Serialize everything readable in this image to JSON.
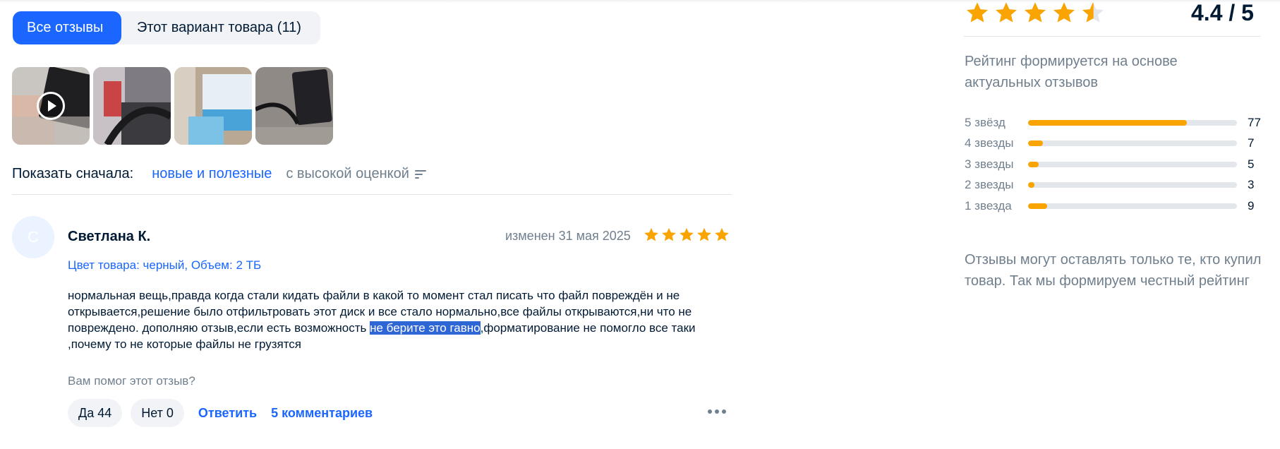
{
  "tabs": {
    "all_reviews": "Все отзывы",
    "this_variant": "Этот вариант товара (11)"
  },
  "photos": [
    {
      "name": "photo-video",
      "has_play": true
    },
    {
      "name": "photo-2",
      "has_play": false
    },
    {
      "name": "photo-3",
      "has_play": false
    },
    {
      "name": "photo-4",
      "has_play": false
    }
  ],
  "sort": {
    "label": "Показать сначала:",
    "option_active": "новые и полезные",
    "option_other": "с высокой оценкой"
  },
  "review": {
    "avatar_letter": "С",
    "author": "Светлана К.",
    "date": "изменен 31 мая 2025",
    "stars": 5,
    "variant": "Цвет товара: черный, Объем: 2 ТБ",
    "text_before": "нормальная вещь,правда когда стали кидать файли в какой то момент стал писать что файл повреждён и не открывается,решение было отфильтровать этот диск и все стало нормально,все файлы открываются,ни что не повреждено. дополняю отзыв,если есть возможность ",
    "text_selected": "не берите это гавно",
    "text_after": ",форматирование не помогло все таки ,почему то не которые файлы не грузятся",
    "helpful_question": "Вам помог этот отзыв?",
    "yes_label": "Да 44",
    "no_label": "Нет 0",
    "reply_label": "Ответить",
    "comments_label": "5 комментариев"
  },
  "summary": {
    "rating": 4.4,
    "score_text": "4.4 / 5",
    "note": "Рейтинг формируется на основе актуальных отзывов",
    "distribution": [
      {
        "label": "5 звёзд",
        "count": "77",
        "fraction": 0.76
      },
      {
        "label": "4 звезды",
        "count": "7",
        "fraction": 0.07
      },
      {
        "label": "3 звезды",
        "count": "5",
        "fraction": 0.05
      },
      {
        "label": "2 звезды",
        "count": "3",
        "fraction": 0.03
      },
      {
        "label": "1 звезда",
        "count": "9",
        "fraction": 0.09
      }
    ],
    "bottom_note": "Отзывы могут оставлять только те, кто купил товар. Так мы формируем честный рейтинг"
  },
  "colors": {
    "accent": "#1a66ff",
    "star": "#f9a400",
    "muted": "#707f8d",
    "text": "#001a34",
    "selection": "#2f66d6"
  }
}
